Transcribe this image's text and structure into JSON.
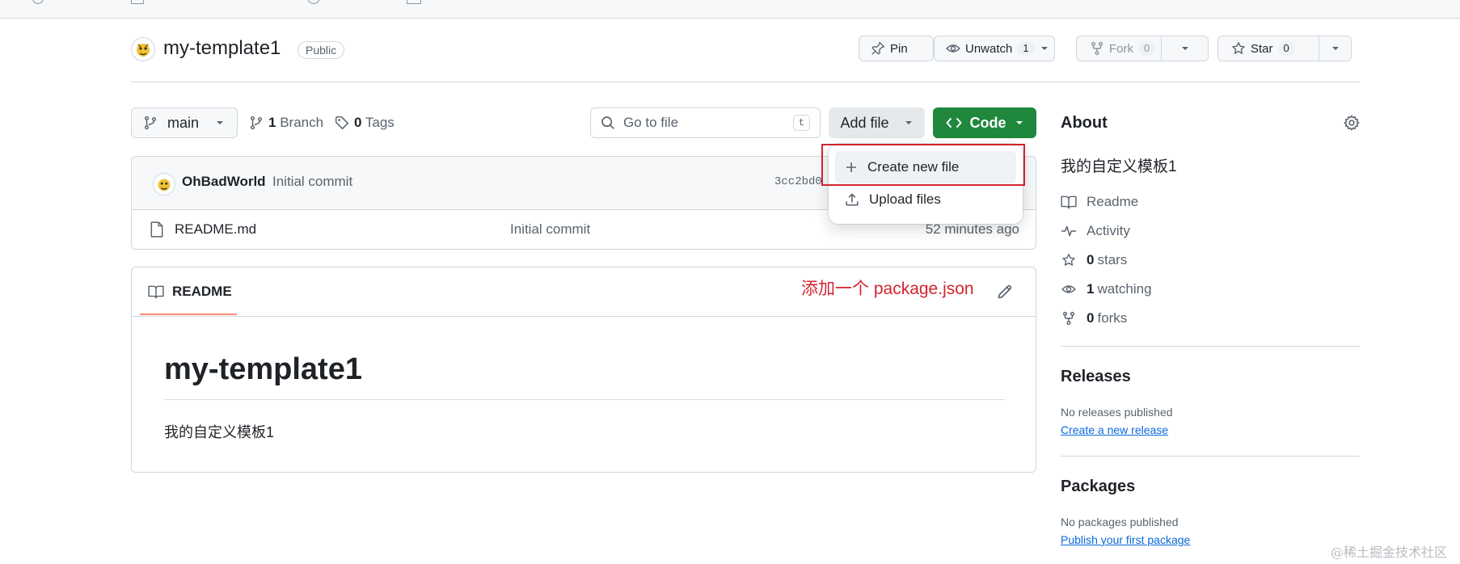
{
  "repo": {
    "name": "my-template1",
    "visibility": "Public",
    "actions": {
      "pin_label": "Pin",
      "unwatch_label": "Unwatch",
      "watch_count": "1",
      "fork_label": "Fork",
      "fork_count": "0",
      "star_label": "Star",
      "star_count": "0"
    }
  },
  "branch_bar": {
    "branch": "main",
    "branch_count": "1",
    "branch_label": "Branch",
    "tag_count": "0",
    "tag_label": "Tags",
    "goto_placeholder": "Go to file",
    "goto_shortcut": "t",
    "add_file_label": "Add file",
    "code_label": "Code"
  },
  "add_file_menu": {
    "items": [
      {
        "label": "Create new file",
        "icon": "plus-icon"
      },
      {
        "label": "Upload files",
        "icon": "upload-icon"
      }
    ]
  },
  "latest_commit": {
    "author": "OhBadWorld",
    "message": "Initial commit",
    "hash": "3cc2bd0"
  },
  "files": [
    {
      "name": "README.md",
      "message": "Initial commit",
      "time": "52 minutes ago"
    }
  ],
  "readme": {
    "tab_label": "README",
    "annotation": "添加一个 package.json",
    "heading": "my-template1",
    "body": "我的自定义模板1"
  },
  "about": {
    "title": "About",
    "description": "我的自定义模板1",
    "readme_label": "Readme",
    "activity_label": "Activity",
    "stars_count": "0",
    "stars_label": "stars",
    "watching_count": "1",
    "watching_label": "watching",
    "forks_count": "0",
    "forks_label": "forks"
  },
  "releases": {
    "title": "Releases",
    "empty_text": "No releases published",
    "link": "Create a new release"
  },
  "packages": {
    "title": "Packages",
    "empty_text": "No packages published",
    "link": "Publish your first package"
  },
  "watermark": "@稀土掘金技术社区",
  "colors": {
    "accent_green": "#1f883d",
    "link_blue": "#0969da",
    "annotation_red": "#d1242f",
    "tab_underline": "#fd8c73"
  }
}
